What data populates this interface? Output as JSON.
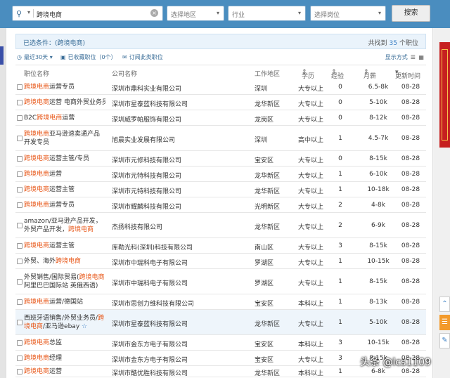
{
  "search": {
    "value": "跨境电商",
    "region_placeholder": "选择地区",
    "industry_placeholder": "行业",
    "position_placeholder": "选择岗位",
    "button": "搜索"
  },
  "condition": {
    "label": "已选条件：(跨境电商)",
    "found_prefix": "共找到",
    "found_count": "35",
    "found_suffix": "个职位"
  },
  "toolbar": {
    "recent": "最近30天",
    "saved": "已收藏职位（0个）",
    "subscribe": "订阅此类职位",
    "display_mode": "显示方式"
  },
  "columns": {
    "title": "职位名称",
    "company": "公司名称",
    "area": "工作地区",
    "edu": "学历",
    "exp": "经验",
    "salary": "月薪",
    "date": "更新时间"
  },
  "rows": [
    {
      "pre": "",
      "kw": "跨境电商",
      "post": "运营专员",
      "company": "深圳市鼎科实业有限公司",
      "area": "深圳",
      "edu": "大专以上",
      "exp": "0",
      "salary": "6.5-8k",
      "date": "08-28"
    },
    {
      "pre": "",
      "kw": "跨境电商",
      "post": "运营 电商外贸业务员",
      "company": "深圳市星泰蓝科技有限公司",
      "area": "龙华新区",
      "edu": "大专以上",
      "exp": "0",
      "salary": "5-10k",
      "date": "08-28"
    },
    {
      "pre": "B2C",
      "kw": "跨境电商",
      "post": "运营",
      "company": "深圳威罗帕服饰有限公司",
      "area": "龙岗区",
      "edu": "大专以上",
      "exp": "0",
      "salary": "8-12k",
      "date": "08-28"
    },
    {
      "pre": "",
      "kw": "跨境电商",
      "post": "亚马逊速卖通产品开发专员",
      "company": "旭晨实业发展有限公司",
      "area": "深圳",
      "edu": "高中以上",
      "exp": "1",
      "salary": "4.5-7k",
      "date": "08-28"
    },
    {
      "pre": "",
      "kw": "跨境电商",
      "post": "运营主管/专员",
      "company": "深圳市元修科技有限公司",
      "area": "宝安区",
      "edu": "大专以上",
      "exp": "0",
      "salary": "8-15k",
      "date": "08-28"
    },
    {
      "pre": "",
      "kw": "跨境电商",
      "post": "运营",
      "company": "深圳市元特科技有限公司",
      "area": "龙华新区",
      "edu": "大专以上",
      "exp": "1",
      "salary": "6-10k",
      "date": "08-28"
    },
    {
      "pre": "",
      "kw": "跨境电商",
      "post": "运营主管",
      "company": "深圳市元特科技有限公司",
      "area": "龙华新区",
      "edu": "大专以上",
      "exp": "1",
      "salary": "10-18k",
      "date": "08-28"
    },
    {
      "pre": "",
      "kw": "跨境电商",
      "post": "运营专员",
      "company": "深圳市耀麟科技有限公司",
      "area": "光明新区",
      "edu": "大专以上",
      "exp": "2",
      "salary": "4-8k",
      "date": "08-28"
    },
    {
      "pre": "amazon/亚马逊产品开发，外贸产品开发，",
      "kw": "跨境电商",
      "post": "",
      "company": "杰扬科技有限公司",
      "area": "龙华新区",
      "edu": "大专以上",
      "exp": "2",
      "salary": "6-9k",
      "date": "08-28"
    },
    {
      "pre": "",
      "kw": "跨境电商",
      "post": "运营主管",
      "company": "库勒光科(深圳)科技有限公司",
      "area": "南山区",
      "edu": "大专以上",
      "exp": "3",
      "salary": "8-15k",
      "date": "08-28"
    },
    {
      "pre": "外贸、海外",
      "kw": "跨境电商",
      "post": "",
      "company": "深圳市中瑞科电子有限公司",
      "area": "罗湖区",
      "edu": "大专以上",
      "exp": "1",
      "salary": "10-15k",
      "date": "08-28"
    },
    {
      "pre": "外贸销售/国际贸易(",
      "kw": "跨境电商",
      "post": " 阿里巴巴国际站 英俄西语)",
      "company": "深圳市中瑞科电子有限公司",
      "area": "罗湖区",
      "edu": "大专以上",
      "exp": "1",
      "salary": "8-15k",
      "date": "08-28"
    },
    {
      "pre": "",
      "kw": "跨境电商",
      "post": "运营/德国站",
      "company": "深圳市思创力维科技有限公司",
      "area": "宝安区",
      "edu": "本科以上",
      "exp": "1",
      "salary": "8-13k",
      "date": "08-28"
    },
    {
      "pre": "西班牙语销售/外贸业务员/",
      "kw": "跨境电商",
      "post": "/亚马逊ebay",
      "company": "深圳市星泰蓝科技有限公司",
      "area": "龙华新区",
      "edu": "大专以上",
      "exp": "1",
      "salary": "5-10k",
      "date": "08-28",
      "star": "☆"
    },
    {
      "pre": "",
      "kw": "跨境电商",
      "post": "总监",
      "company": "深圳市金东方电子有限公司",
      "area": "宝安区",
      "edu": "本科以上",
      "exp": "3",
      "salary": "10-15k",
      "date": "08-28"
    },
    {
      "pre": "",
      "kw": "跨境电商",
      "post": "经理",
      "company": "深圳市金东方电子有限公司",
      "area": "宝安区",
      "edu": "大专以上",
      "exp": "3",
      "salary": "8-15k",
      "date": "08-28"
    },
    {
      "pre": "",
      "kw": "跨境电商",
      "post": "运营",
      "company": "深圳市酷优胜科技有限公司",
      "area": "龙华新区",
      "edu": "本科以上",
      "exp": "1",
      "salary": "6-8k",
      "date": "08-28"
    }
  ],
  "watermark": "头条 @lcs1109",
  "icons": {
    "search": "search-icon",
    "clear": "clear-icon",
    "dropdown": "chevron-down-icon",
    "clock": "clock-icon",
    "bookmark": "bookmark-icon",
    "rss": "subscribe-icon",
    "list": "list-view-icon"
  },
  "colors": {
    "topbar": "#4a8dbf",
    "keyword": "#e8591b",
    "link": "#3b7fc4"
  }
}
